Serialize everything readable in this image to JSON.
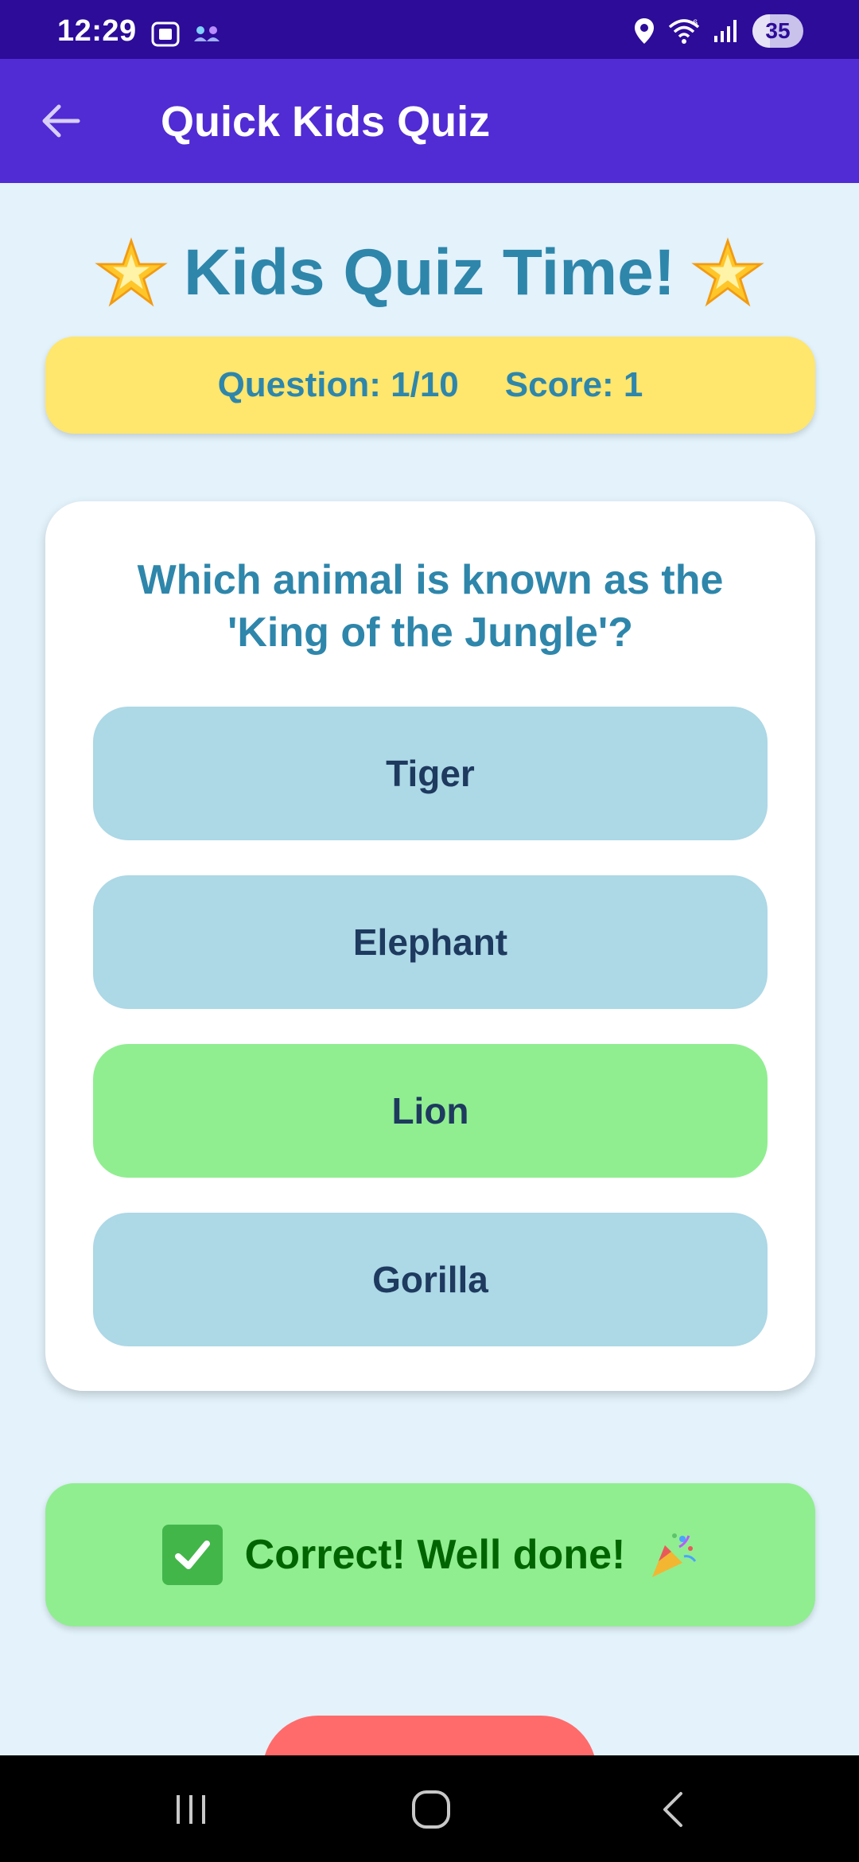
{
  "status_bar": {
    "time": "12:29",
    "battery": "35",
    "icons": [
      "screenshot-icon",
      "tether-icon",
      "location-icon",
      "wifi-icon",
      "signal-icon",
      "battery-icon"
    ]
  },
  "app_bar": {
    "title": "Quick Kids Quiz",
    "back_icon": "arrow-left-icon"
  },
  "header": {
    "title": "Kids Quiz Time!",
    "decoration_icon": "star-emoji-icon"
  },
  "score_bar": {
    "question_label": "Question: 1/10",
    "score_label": "Score: 1"
  },
  "quiz": {
    "question": "Which animal is known as the 'King of the Jungle'?",
    "answers": [
      {
        "label": "Tiger",
        "state": "default"
      },
      {
        "label": "Elephant",
        "state": "default"
      },
      {
        "label": "Lion",
        "state": "correct"
      },
      {
        "label": "Gorilla",
        "state": "default"
      }
    ]
  },
  "feedback": {
    "message": "Correct! Well done!",
    "icons": [
      "check-mark-icon",
      "party-popper-icon"
    ]
  },
  "colors": {
    "status_bar": "#2c0c99",
    "app_bar": "#512bd4",
    "background": "#e3f2fb",
    "title_text": "#2e86ab",
    "score_bar": "#ffe66d",
    "answer_default": "#add8e6",
    "answer_correct": "#90ee90",
    "feedback_text": "#006400",
    "next_button": "#ff6b6b"
  },
  "nav_bar": {
    "buttons": [
      "recent-apps-icon",
      "home-icon",
      "back-icon"
    ]
  }
}
